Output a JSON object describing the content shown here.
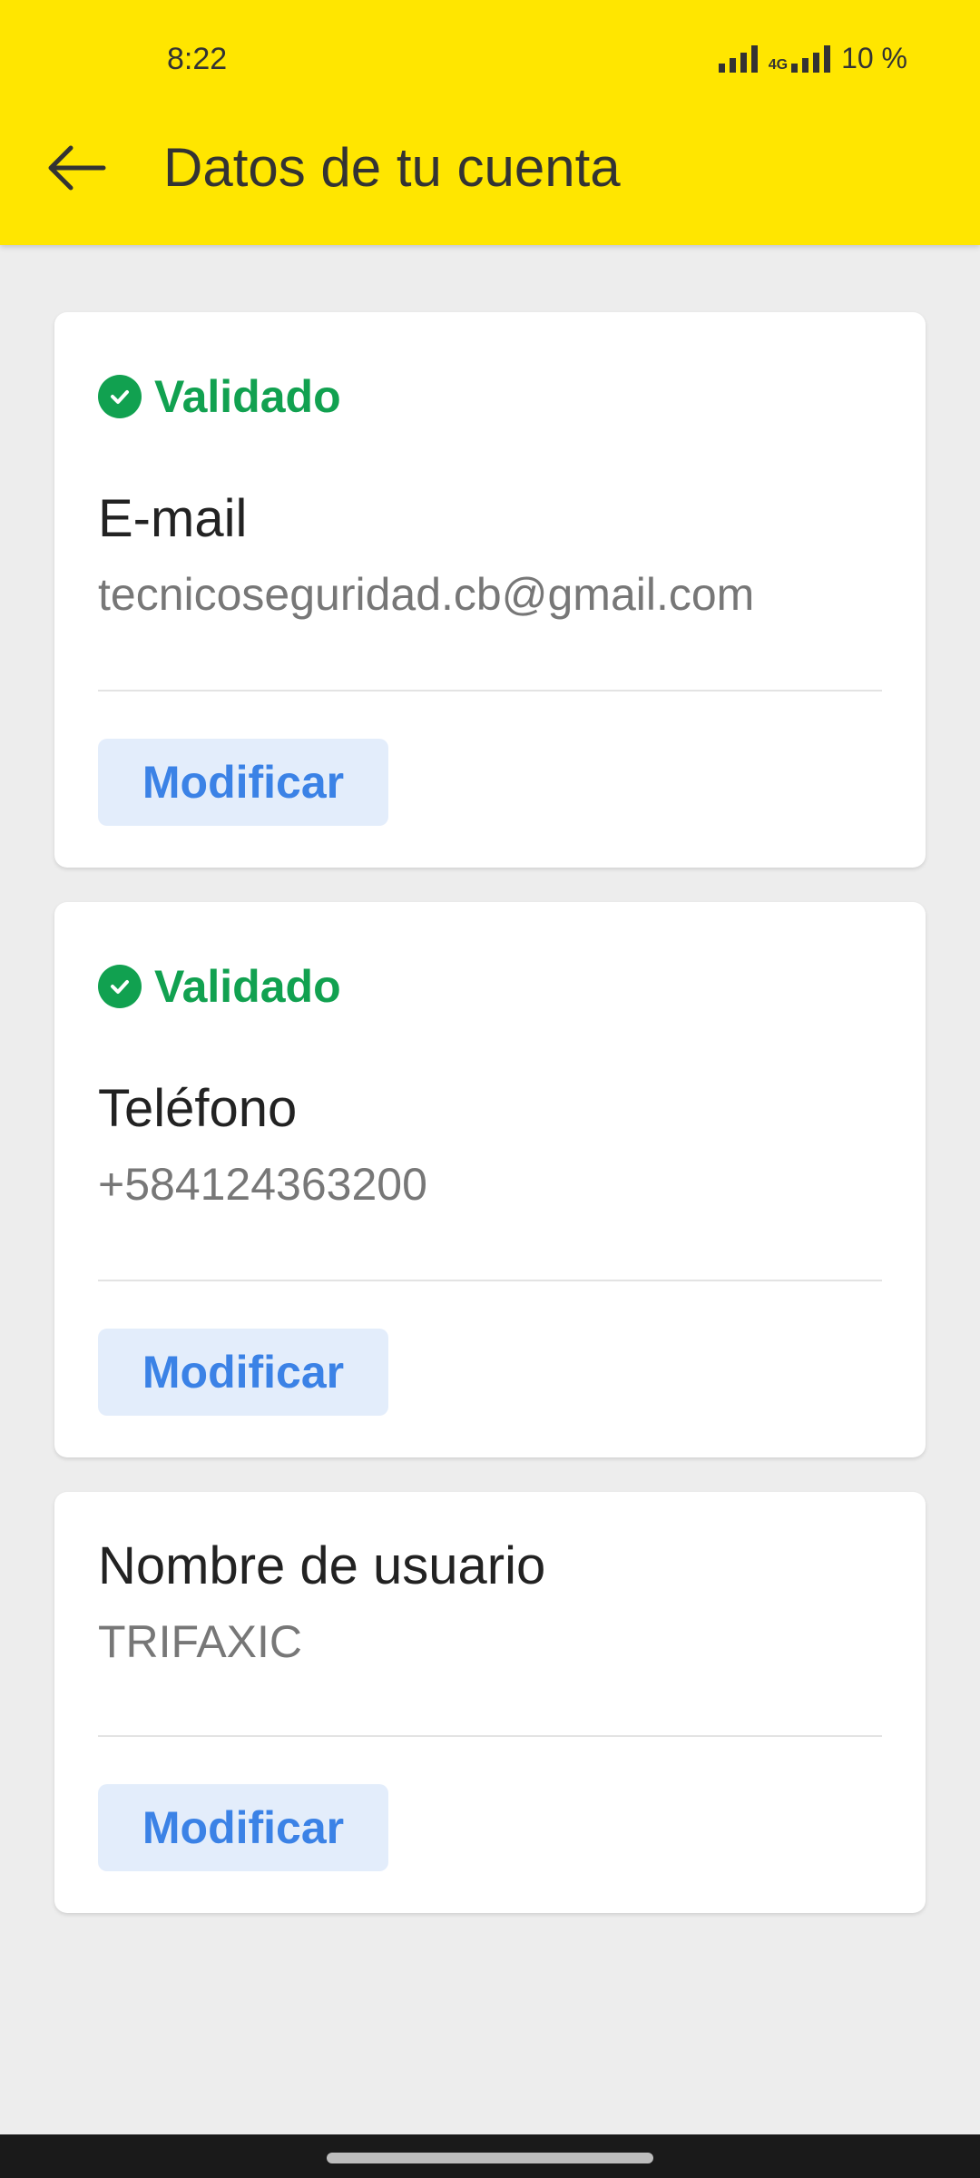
{
  "status_bar": {
    "time": "8:22",
    "network": "4G",
    "battery": "10 %"
  },
  "header": {
    "title": "Datos de tu cuenta",
    "back_icon": "arrow-left-icon",
    "background_color": "#ffe600"
  },
  "cards": [
    {
      "validated_label": "Validado",
      "label": "E-mail",
      "value": "tecnicoseguridad.cb@gmail.com",
      "button_label": "Modificar"
    },
    {
      "validated_label": "Validado",
      "label": "Teléfono",
      "value": "+584124363200",
      "button_label": "Modificar"
    },
    {
      "label": "Nombre de usuario",
      "value": "TRIFAXIC",
      "button_label": "Modificar"
    }
  ],
  "colors": {
    "accent_yellow": "#ffe600",
    "validated_green": "#11a150",
    "button_blue": "#3b82e6",
    "button_bg": "#e3edfb"
  }
}
